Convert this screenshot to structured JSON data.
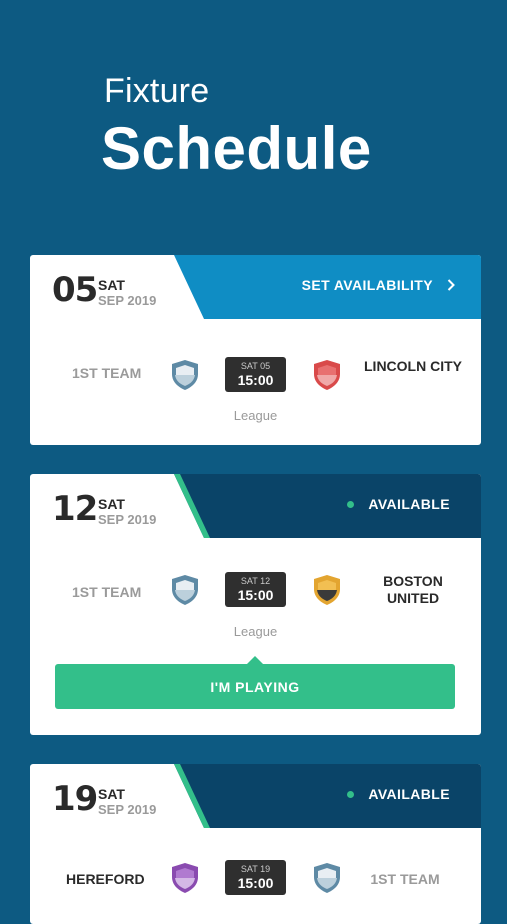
{
  "header": {
    "title_top": "Fixture",
    "title_main": "Schedule"
  },
  "colors": {
    "background": "#0d5a82",
    "accent_blue": "#0f8dc4",
    "accent_navy": "#0a4468",
    "available_green": "#33bf8a"
  },
  "fixtures": [
    {
      "day": "05",
      "weekday": "SAT",
      "month": "SEP 2019",
      "action": "SET AVAILABILITY",
      "home": "1ST TEAM",
      "away": "LINCOLN CITY",
      "time_day": "SAT 05",
      "time": "15:00",
      "competition": "League"
    },
    {
      "day": "12",
      "weekday": "SAT",
      "month": "SEP 2019",
      "status": "AVAILABLE",
      "home": "1ST TEAM",
      "away": "BOSTON UNITED",
      "time_day": "SAT 12",
      "time": "15:00",
      "competition": "League",
      "button": "I'M PLAYING"
    },
    {
      "day": "19",
      "weekday": "SAT",
      "month": "SEP 2019",
      "status": "AVAILABLE",
      "home": "HEREFORD",
      "away": "1ST TEAM",
      "time_day": "SAT 19",
      "time": "15:00"
    }
  ]
}
